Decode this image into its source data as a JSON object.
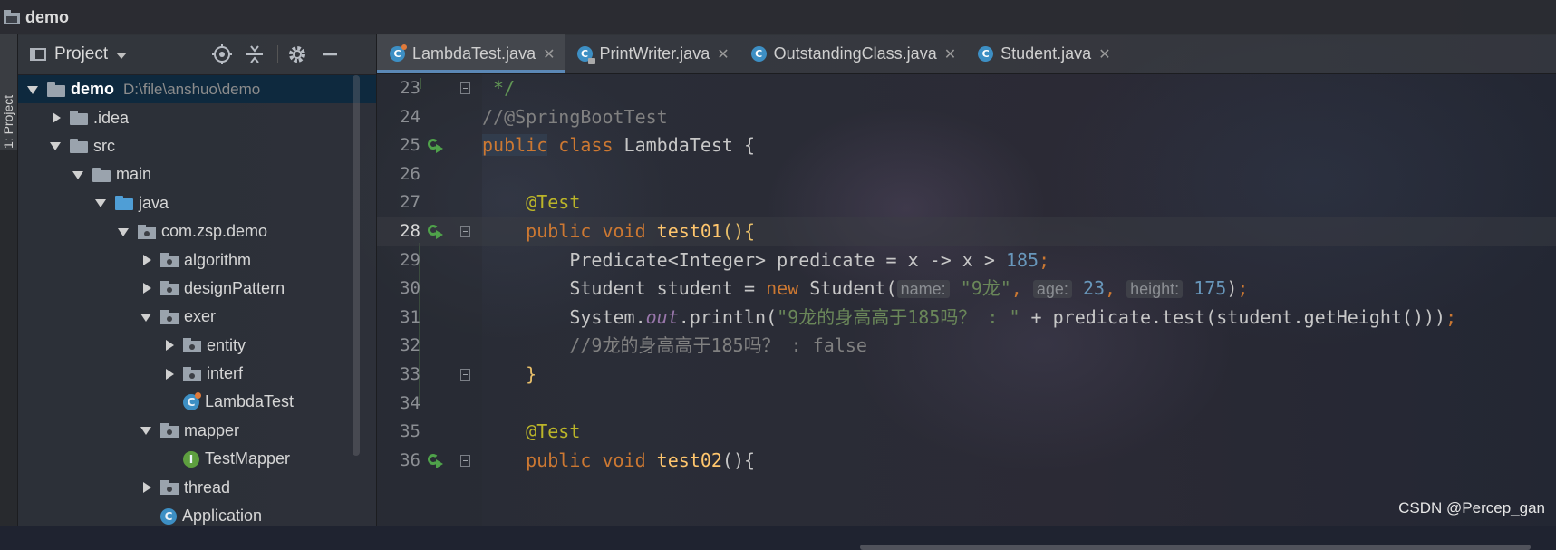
{
  "window": {
    "title": "demo"
  },
  "sidebar_tab": {
    "label": "1: Project"
  },
  "project_panel": {
    "title": "Project",
    "tree": [
      {
        "label": "demo",
        "path": "D:\\file\\anshuo\\demo",
        "depth": 0,
        "arrow": "d",
        "icon": "folder",
        "selected": true
      },
      {
        "label": ".idea",
        "depth": 1,
        "arrow": "r",
        "icon": "folder"
      },
      {
        "label": "src",
        "depth": 1,
        "arrow": "d",
        "icon": "folder"
      },
      {
        "label": "main",
        "depth": 2,
        "arrow": "d",
        "icon": "folder"
      },
      {
        "label": "java",
        "depth": 3,
        "arrow": "d",
        "icon": "folder-blue"
      },
      {
        "label": "com.zsp.demo",
        "depth": 4,
        "arrow": "d",
        "icon": "package"
      },
      {
        "label": "algorithm",
        "depth": 5,
        "arrow": "r",
        "icon": "package"
      },
      {
        "label": "designPattern",
        "depth": 5,
        "arrow": "r",
        "icon": "package"
      },
      {
        "label": "exer",
        "depth": 5,
        "arrow": "d",
        "icon": "package"
      },
      {
        "label": "entity",
        "depth": 6,
        "arrow": "r",
        "icon": "package"
      },
      {
        "label": "interf",
        "depth": 6,
        "arrow": "r",
        "icon": "package"
      },
      {
        "label": "LambdaTest",
        "depth": 6,
        "arrow": "n",
        "icon": "class-test"
      },
      {
        "label": "mapper",
        "depth": 5,
        "arrow": "d",
        "icon": "package"
      },
      {
        "label": "TestMapper",
        "depth": 6,
        "arrow": "n",
        "icon": "interface"
      },
      {
        "label": "thread",
        "depth": 5,
        "arrow": "r",
        "icon": "package"
      },
      {
        "label": "Application",
        "depth": 5,
        "arrow": "n",
        "icon": "class"
      }
    ]
  },
  "tabs": [
    {
      "label": "LambdaTest.java",
      "active": true,
      "icon": "test"
    },
    {
      "label": "PrintWriter.java",
      "active": false,
      "icon": "lock"
    },
    {
      "label": "OutstandingClass.java",
      "active": false,
      "icon": "class"
    },
    {
      "label": "Student.java",
      "active": false,
      "icon": "class"
    }
  ],
  "editor": {
    "current_line": 28,
    "lines": [
      {
        "n": 23,
        "tokens": [
          [
            "cmg",
            " */"
          ]
        ],
        "fold": true
      },
      {
        "n": 24,
        "tokens": [
          [
            "cm",
            "//@SpringBootTest"
          ]
        ]
      },
      {
        "n": 25,
        "run": true,
        "tokens": [
          [
            "kw hl",
            "public"
          ],
          [
            "kw",
            " class "
          ],
          [
            "",
            "LambdaTest {"
          ]
        ]
      },
      {
        "n": 26,
        "tokens": []
      },
      {
        "n": 27,
        "tokens": [
          [
            "",
            "    "
          ],
          [
            "ann",
            "@Test"
          ]
        ]
      },
      {
        "n": 28,
        "run": true,
        "fold": true,
        "tokens": [
          [
            "",
            "    "
          ],
          [
            "kw",
            "public void "
          ],
          [
            "fn",
            "test01"
          ],
          [
            "brace",
            "(){"
          ]
        ]
      },
      {
        "n": 29,
        "tokens": [
          [
            "",
            "        Predicate<Integer> predicate = x -> x > "
          ],
          [
            "num-lit",
            "185"
          ],
          [
            "kw",
            ";"
          ]
        ]
      },
      {
        "n": 30,
        "tokens": [
          [
            "",
            "        Student student = "
          ],
          [
            "kw",
            "new "
          ],
          [
            "",
            "Student("
          ],
          [
            "hint",
            "name:"
          ],
          [
            "str",
            " \"9龙\""
          ],
          [
            "kw",
            ","
          ],
          [
            "",
            " "
          ],
          [
            "hint",
            "age:"
          ],
          [
            "num-lit",
            " 23"
          ],
          [
            "kw",
            ","
          ],
          [
            "",
            " "
          ],
          [
            "hint",
            "height:"
          ],
          [
            "num-lit",
            " 175"
          ],
          [
            "",
            ")"
          ],
          [
            "kw",
            ";"
          ]
        ]
      },
      {
        "n": 31,
        "tokens": [
          [
            "",
            "        System."
          ],
          [
            "it",
            "out"
          ],
          [
            "",
            ".println("
          ],
          [
            "str",
            "\"9龙的身高高于185吗？ : \""
          ],
          [
            "",
            " + predicate.test(student.getHeight()))"
          ],
          [
            "kw",
            ";"
          ]
        ]
      },
      {
        "n": 32,
        "tokens": [
          [
            "cm",
            "        //9龙的身高高于185吗？ : false"
          ]
        ]
      },
      {
        "n": 33,
        "fold": true,
        "tokens": [
          [
            "",
            "    "
          ],
          [
            "brace",
            "}"
          ]
        ]
      },
      {
        "n": 34,
        "tokens": []
      },
      {
        "n": 35,
        "tokens": [
          [
            "",
            "    "
          ],
          [
            "ann",
            "@Test"
          ]
        ]
      },
      {
        "n": 36,
        "run": true,
        "fold": true,
        "tokens": [
          [
            "",
            "    "
          ],
          [
            "kw",
            "public void "
          ],
          [
            "fn",
            "test02"
          ],
          [
            "",
            "(){"
          ]
        ]
      }
    ]
  },
  "watermark": "CSDN @Percep_gan"
}
